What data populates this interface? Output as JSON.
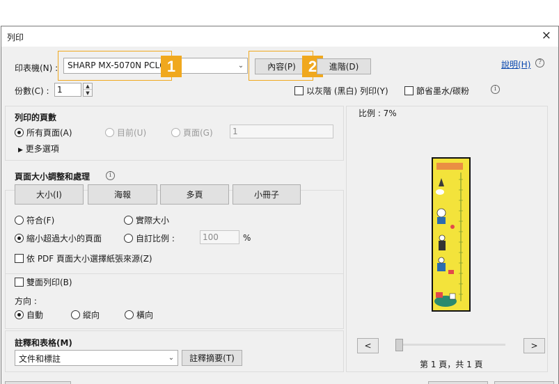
{
  "window": {
    "title": "列印",
    "close_glyph": "×"
  },
  "printer": {
    "label": "印表機(N) :",
    "selected": "SHARP MX-5070N PCL6"
  },
  "buttons": {
    "properties": "內容(P)",
    "advanced": "進階(D)",
    "help": "說明(H)"
  },
  "badges": {
    "one": "1",
    "two": "2"
  },
  "copies": {
    "label": "份數(C) :",
    "value": "1"
  },
  "options": {
    "grayscale": "以灰階 (黑白) 列印(Y)",
    "save_ink": "節省墨水/碳粉"
  },
  "pages": {
    "title": "列印的頁數",
    "all": "所有頁面(A)",
    "current": "目前(U)",
    "range": "頁面(G)",
    "range_value": "1",
    "more": "更多選項"
  },
  "sizing": {
    "title": "頁面大小調整和處理",
    "tabs": [
      "大小(I)",
      "海報",
      "多頁",
      "小冊子"
    ],
    "fit": "符合(F)",
    "actual": "實際大小",
    "shrink": "縮小超過大小的頁面",
    "custom": "自訂比例 :",
    "custom_value": "100",
    "percent": "%",
    "pdf_source": "依 PDF 頁面大小選擇紙張來源(Z)"
  },
  "duplex": {
    "label": "雙面列印(B)"
  },
  "orientation": {
    "title": "方向 :",
    "auto": "自動",
    "portrait": "縱向",
    "landscape": "橫向"
  },
  "comments": {
    "title": "註釋和表格(M)",
    "selected": "文件和標註",
    "summary": "註釋摘要(T)"
  },
  "preview": {
    "scale": "比例 :  7%",
    "page_info": "第 1 頁，共 1 頁",
    "prev": "<",
    "next": ">"
  },
  "colors": {
    "accent": "#f0a81e",
    "link": "#0645ad"
  }
}
